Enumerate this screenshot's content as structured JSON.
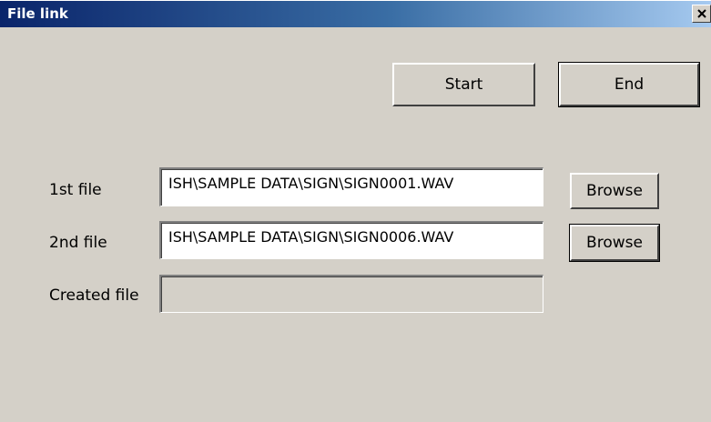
{
  "window": {
    "title": "File link",
    "close_glyph": "×"
  },
  "toolbar": {
    "start_label": "Start",
    "end_label": "End"
  },
  "form": {
    "first_file": {
      "label": "1st file",
      "value": "ISH\\SAMPLE DATA\\SIGN\\SIGN0001.WAV",
      "browse_label": "Browse"
    },
    "second_file": {
      "label": "2nd file",
      "value": "ISH\\SAMPLE DATA\\SIGN\\SIGN0006.WAV",
      "browse_label": "Browse"
    },
    "created_file": {
      "label": "Created file",
      "value": ""
    }
  },
  "colors": {
    "face": "#d4d0c8",
    "title_start": "#0a246a",
    "title_end": "#a6caf0"
  }
}
